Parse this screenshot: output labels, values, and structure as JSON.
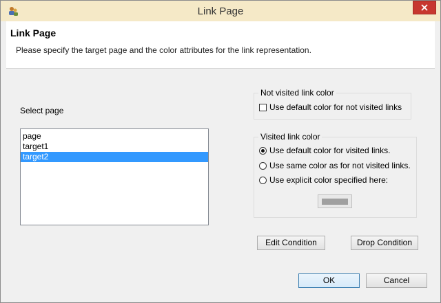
{
  "window": {
    "title": "Link Page"
  },
  "header": {
    "title": "Link Page",
    "description": "Please specify the target page and the color attributes for the link representation."
  },
  "select_page": {
    "label": "Select page",
    "items": [
      "page",
      "target1",
      "target2"
    ],
    "selected_index": 2
  },
  "not_visited": {
    "legend": "Not visited link color",
    "checkbox_label": "Use default color for not visited links",
    "checked": false
  },
  "visited": {
    "legend": "Visited link color",
    "options": [
      {
        "label": "Use default color for visited links.",
        "checked": true
      },
      {
        "label": "Use same color as for not visited links.",
        "checked": false
      },
      {
        "label": "Use explicit color specified here:",
        "checked": false
      }
    ],
    "swatch_color": "#a0a0a0"
  },
  "buttons": {
    "edit_condition": "Edit Condition",
    "drop_condition": "Drop Condition",
    "ok": "OK",
    "cancel": "Cancel"
  },
  "colors": {
    "titlebar": "#f5e9c7",
    "close_button": "#c7372f",
    "selection": "#3399ff"
  }
}
